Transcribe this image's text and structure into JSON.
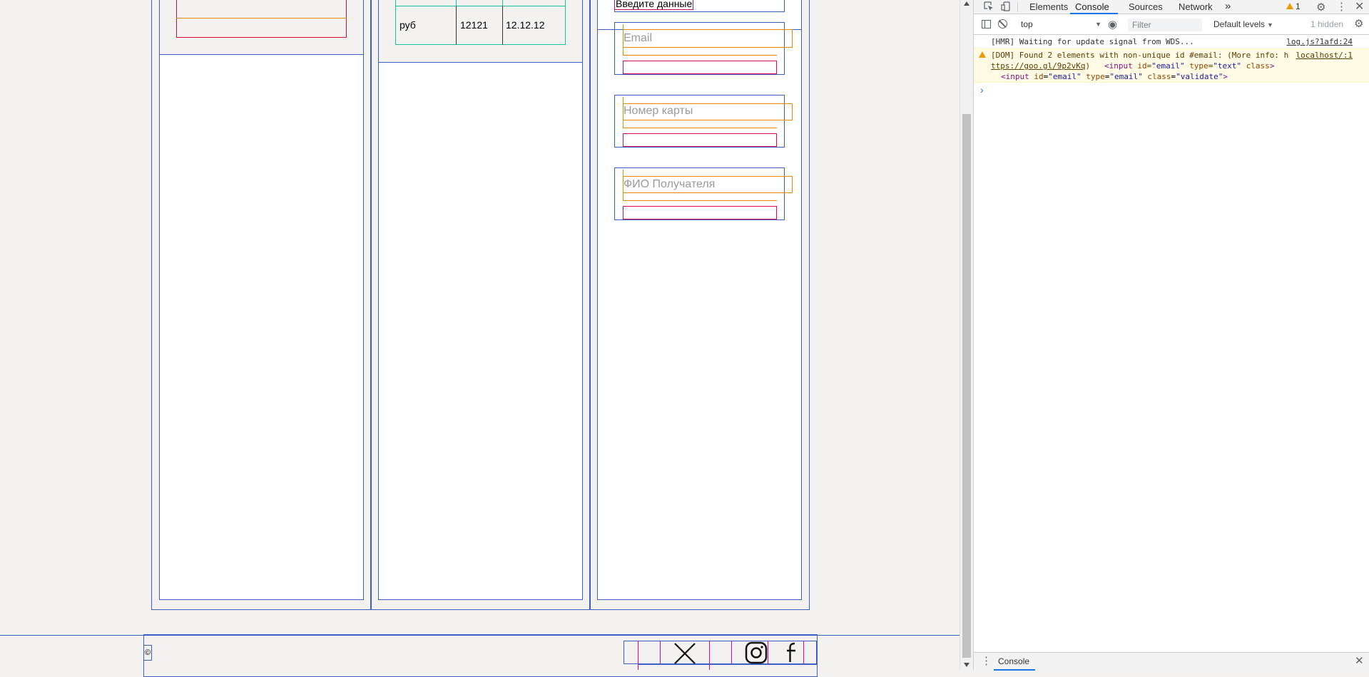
{
  "app": {
    "form": {
      "heading": "Введите данные",
      "fields": [
        {
          "placeholder": "Email"
        },
        {
          "placeholder": "Номер карты"
        },
        {
          "placeholder": "ФИО Получателя"
        }
      ]
    },
    "table": {
      "row": [
        "руб",
        "12121",
        "12.12.12"
      ]
    },
    "footer": {
      "copyright_symbol": "©",
      "social_icons": [
        "x-icon",
        "instagram-icon",
        "facebook-icon"
      ]
    }
  },
  "devtools": {
    "toolbar": {
      "tabs": [
        "Elements",
        "Console",
        "Sources",
        "Network"
      ],
      "more_tabs": "»",
      "warning_count": "1",
      "active_tab": "Console"
    },
    "console_toolbar": {
      "context": "top",
      "filter_placeholder": "Filter",
      "levels": "Default levels",
      "hidden": "1 hidden"
    },
    "messages": [
      {
        "text": "[HMR] Waiting for update signal from WDS...",
        "source": "log.js?1afd:24"
      },
      {
        "text": "[DOM] Found 2 elements with non-unique id #email: (More info: h",
        "link": "ttps://goo.gl/9p2vKq",
        "close_paren": ")",
        "source": "localhost/:1",
        "line2": {
          "tag_open": "<input",
          "id_attr": "id",
          "id_val": "\"email\"",
          "type_attr": "type",
          "type_val": "\"text\"",
          "class_attr": "class",
          "tag_close": ">"
        },
        "line3": {
          "tag_open": "<input",
          "id_attr": "id",
          "id_val": "\"email\"",
          "type_attr": "type",
          "type_val": "\"email\"",
          "class_attr": "class",
          "class_val": "\"validate\"",
          "tag_close": ">"
        }
      }
    ],
    "prompt": "›",
    "drawer": {
      "tab": "Console"
    }
  },
  "colors": {
    "layout_outline": "#3b5fc4",
    "input_outline": "#e88a00",
    "error_outline": "#d90b52",
    "table_outline": "#19c39a",
    "console_warning_bg": "#fffbe5"
  }
}
